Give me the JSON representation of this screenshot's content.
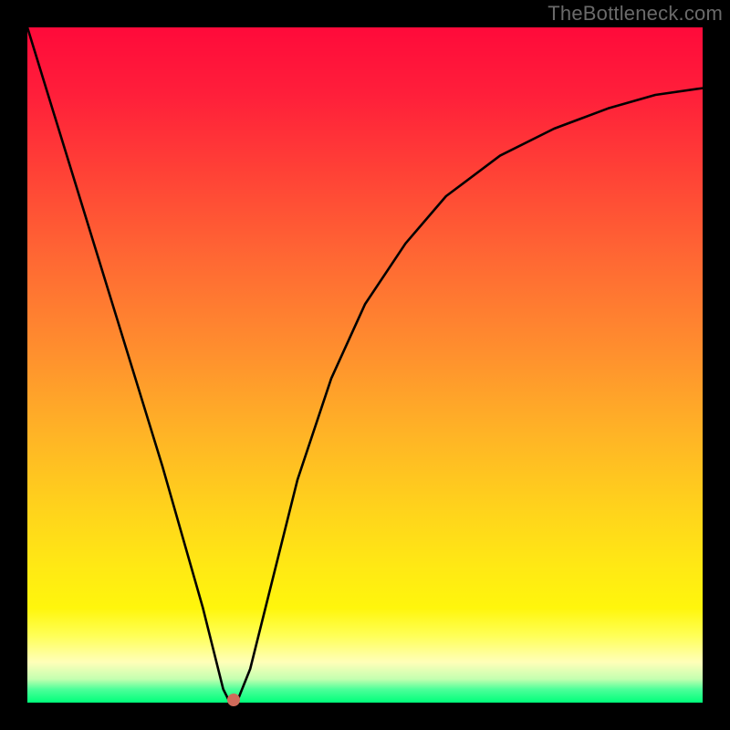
{
  "watermark": "TheBottleneck.com",
  "dot": {
    "x_pct": 30.5,
    "y_pct": 99.6
  },
  "chart_data": {
    "type": "line",
    "title": "",
    "xlabel": "",
    "ylabel": "",
    "xlim": [
      0,
      100
    ],
    "ylim": [
      0,
      100
    ],
    "series": [
      {
        "name": "bottleneck-curve",
        "x": [
          0,
          4,
          8,
          12,
          16,
          20,
          24,
          26,
          28,
          29,
          30,
          31,
          33,
          36,
          40,
          45,
          50,
          56,
          62,
          70,
          78,
          86,
          93,
          100
        ],
        "y": [
          100,
          87,
          74,
          61,
          48,
          35,
          21,
          14,
          6,
          2,
          0,
          0,
          5,
          17,
          33,
          48,
          59,
          68,
          75,
          81,
          85,
          88,
          90,
          91
        ]
      }
    ],
    "marker": {
      "x": 30.5,
      "y": 0
    },
    "annotations": [
      {
        "text": "TheBottleneck.com",
        "position": "top-right"
      }
    ]
  }
}
